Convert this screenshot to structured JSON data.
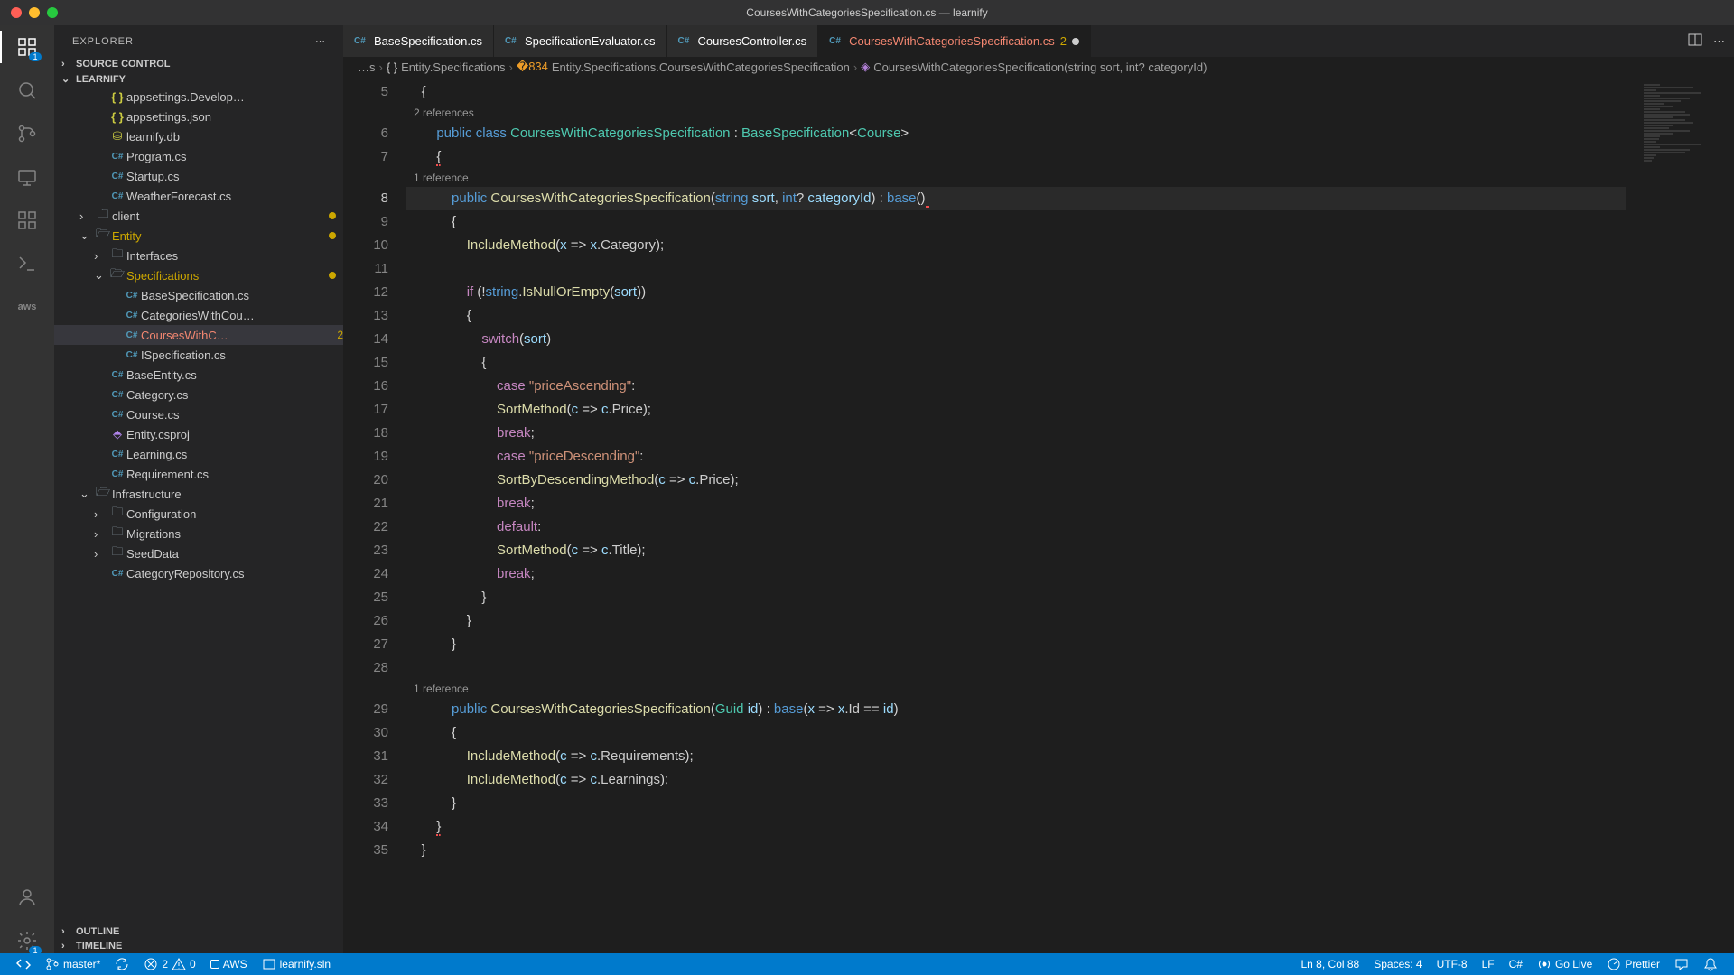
{
  "window": {
    "title": "CoursesWithCategoriesSpecification.cs — learnify"
  },
  "explorer": {
    "title": "EXPLORER",
    "sections": {
      "source_control": "SOURCE CONTROL",
      "workspace": "LEARNIFY",
      "outline": "OUTLINE",
      "timeline": "TIMELINE"
    },
    "tree": [
      {
        "indent": 2,
        "icon": "json",
        "label": "appsettings.Develop…"
      },
      {
        "indent": 2,
        "icon": "json",
        "label": "appsettings.json"
      },
      {
        "indent": 2,
        "icon": "db",
        "label": "learnify.db"
      },
      {
        "indent": 2,
        "icon": "cs",
        "label": "Program.cs"
      },
      {
        "indent": 2,
        "icon": "cs",
        "label": "Startup.cs"
      },
      {
        "indent": 2,
        "icon": "cs",
        "label": "WeatherForecast.cs"
      },
      {
        "indent": 1,
        "icon": "folder",
        "chevron": "right",
        "label": "client",
        "dot": true
      },
      {
        "indent": 1,
        "icon": "folder-open",
        "chevron": "down",
        "label": "Entity",
        "modified": true,
        "dot": true
      },
      {
        "indent": 2,
        "icon": "folder",
        "chevron": "right",
        "label": "Interfaces"
      },
      {
        "indent": 2,
        "icon": "folder-open",
        "chevron": "down",
        "label": "Specifications",
        "modified": true,
        "dot": true
      },
      {
        "indent": 3,
        "icon": "cs",
        "label": "BaseSpecification.cs"
      },
      {
        "indent": 3,
        "icon": "cs",
        "label": "CategoriesWithCou…"
      },
      {
        "indent": 3,
        "icon": "cs",
        "label": "CoursesWithC…",
        "badge": "2",
        "selected": true,
        "error": true
      },
      {
        "indent": 3,
        "icon": "cs",
        "label": "ISpecification.cs"
      },
      {
        "indent": 2,
        "icon": "cs",
        "label": "BaseEntity.cs"
      },
      {
        "indent": 2,
        "icon": "cs",
        "label": "Category.cs"
      },
      {
        "indent": 2,
        "icon": "cs",
        "label": "Course.cs"
      },
      {
        "indent": 2,
        "icon": "proj",
        "label": "Entity.csproj"
      },
      {
        "indent": 2,
        "icon": "cs",
        "label": "Learning.cs"
      },
      {
        "indent": 2,
        "icon": "cs",
        "label": "Requirement.cs"
      },
      {
        "indent": 1,
        "icon": "folder-open",
        "chevron": "down",
        "label": "Infrastructure"
      },
      {
        "indent": 2,
        "icon": "folder",
        "chevron": "right",
        "label": "Configuration"
      },
      {
        "indent": 2,
        "icon": "folder",
        "chevron": "right",
        "label": "Migrations"
      },
      {
        "indent": 2,
        "icon": "folder",
        "chevron": "right",
        "label": "SeedData"
      },
      {
        "indent": 2,
        "icon": "cs",
        "label": "CategoryRepository.cs"
      }
    ]
  },
  "tabs": [
    {
      "label": "BaseSpecification.cs",
      "icon": "cs"
    },
    {
      "label": "SpecificationEvaluator.cs",
      "icon": "cs"
    },
    {
      "label": "CoursesController.cs",
      "icon": "cs"
    },
    {
      "label": "CoursesWithCategoriesSpecification.cs",
      "icon": "cs",
      "active": true,
      "badge": "2",
      "dirty": true,
      "error": true
    }
  ],
  "breadcrumbs": [
    {
      "label": "…s"
    },
    {
      "icon": "ns",
      "label": "Entity.Specifications"
    },
    {
      "icon": "class",
      "label": "Entity.Specifications.CoursesWithCategoriesSpecification"
    },
    {
      "icon": "method",
      "label": "CoursesWithCategoriesSpecification(string sort, int? categoryId)"
    }
  ],
  "code": {
    "first_line_number": 5,
    "codelens1": "2 references",
    "codelens2": "1 reference",
    "codelens3": "1 reference",
    "current_line": 8
  },
  "status": {
    "remote_icon": "remote",
    "branch": "master*",
    "sync": "sync",
    "errors": "2",
    "warnings": "0",
    "aws": "AWS",
    "solution": "learnify.sln",
    "position": "Ln 8, Col 88",
    "spaces": "Spaces: 4",
    "encoding": "UTF-8",
    "eol": "LF",
    "language": "C#",
    "golive": "Go Live",
    "prettier": "Prettier"
  },
  "activity_badges": {
    "explorer": "1",
    "settings": "1"
  }
}
